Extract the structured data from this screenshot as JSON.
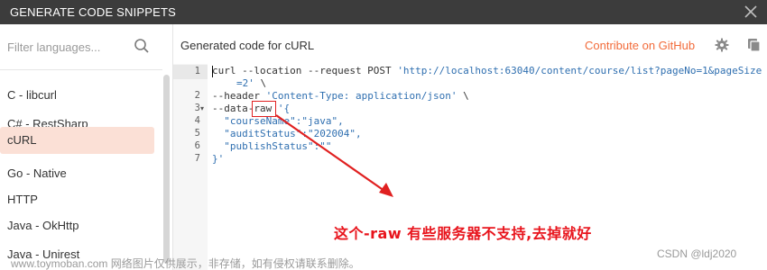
{
  "dialog": {
    "title": "GENERATE CODE SNIPPETS"
  },
  "sidebar": {
    "search_placeholder": "Filter languages...",
    "items": [
      {
        "label": "C - libcurl"
      },
      {
        "label": "C# - RestSharp"
      },
      {
        "label": "cURL",
        "selected": true
      },
      {
        "label": "Go - Native"
      },
      {
        "label": "HTTP"
      },
      {
        "label": "Java - OkHttp"
      },
      {
        "label": "Java - Unirest"
      }
    ]
  },
  "header": {
    "title": "Generated code for cURL",
    "contribute": "Contribute on GitHub"
  },
  "code": {
    "line_numbers": [
      "1",
      "2",
      "3",
      "4",
      "5",
      "6",
      "7"
    ],
    "line1a": "curl --location --request POST ",
    "line1b": "'http://localhost:63040/content/course/list?pageNo=1&pageSize",
    "line1c": "=2'",
    "line1d": " \\",
    "line2a": "--header ",
    "line2b": "'Content-Type: application/json'",
    "line2c": " \\",
    "line3a": "--data-raw ",
    "line3b": "'{",
    "line4": "  \"courseName\":\"java\",",
    "line5": "  \"auditStatus\":\"202004\",",
    "line6": "  \"publishStatus\":\"\"",
    "line7": "}'"
  },
  "annotation": {
    "text": "这个-raw 有些服务器不支持,去掉就好",
    "color": "#e8141c"
  },
  "watermark": "www.toymoban.com 网络图片仅供展示，非存储，如有侵权请联系删除。",
  "credit": "CSDN @ldj2020",
  "colors": {
    "accent": "#f26b3a",
    "titlebar": "#3c3c3c",
    "selected_bg": "#fbe0d6",
    "string": "#2f6fb0"
  }
}
